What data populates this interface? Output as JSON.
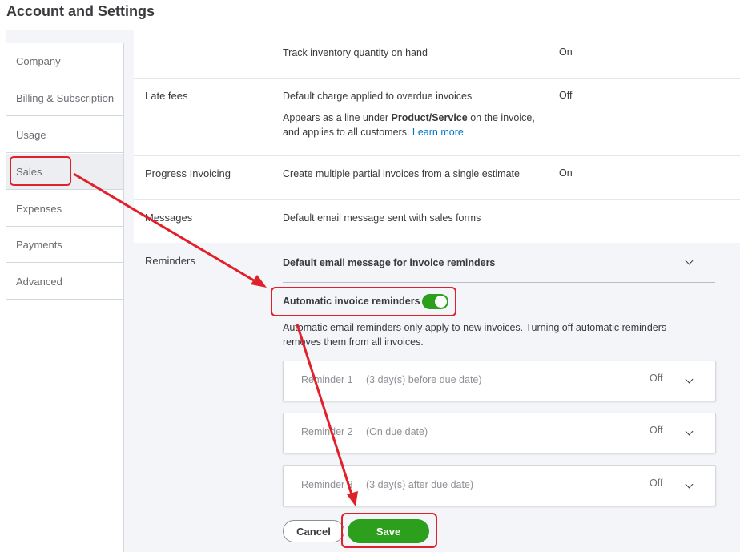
{
  "page": {
    "title": "Account and Settings"
  },
  "sidebar": {
    "items": [
      {
        "label": "Company"
      },
      {
        "label": "Billing & Subscription"
      },
      {
        "label": "Usage"
      },
      {
        "label": "Sales"
      },
      {
        "label": "Expenses"
      },
      {
        "label": "Payments"
      },
      {
        "label": "Advanced"
      }
    ],
    "active": "Sales"
  },
  "settings": {
    "inventory": {
      "description": "Track inventory quantity on hand",
      "value": "On"
    },
    "late_fees": {
      "label": "Late fees",
      "description": "Default charge applied to overdue invoices",
      "value": "Off",
      "note_part1": "Appears as a line under",
      "note_bold": "Product/Service",
      "note_part2": "on the invoice,",
      "note_line2": "and applies to all customers.",
      "learn_more": "Learn more"
    },
    "progress_invoicing": {
      "label": "Progress Invoicing",
      "description": "Create multiple partial invoices from a single estimate",
      "value": "On"
    },
    "messages": {
      "label": "Messages",
      "description": "Default email message sent with sales forms"
    },
    "reminders": {
      "label": "Reminders",
      "header": "Default email message for invoice reminders",
      "auto_label": "Automatic invoice reminders",
      "auto_enabled": true,
      "info_line1": "Automatic email reminders only apply to new invoices. Turning off automatic reminders",
      "info_line2": "removes them from all invoices.",
      "items": [
        {
          "name": "Reminder 1",
          "detail": "(3 day(s) before due date)",
          "state": "Off"
        },
        {
          "name": "Reminder 2",
          "detail": "(On due date)",
          "state": "Off"
        },
        {
          "name": "Reminder 3",
          "detail": "(3 day(s) after due date)",
          "state": "Off"
        }
      ]
    }
  },
  "actions": {
    "cancel": "Cancel",
    "save": "Save"
  },
  "colors": {
    "accent_green": "#2ca01c",
    "annotation_red": "#e0202a",
    "link_blue": "#0077c5"
  }
}
